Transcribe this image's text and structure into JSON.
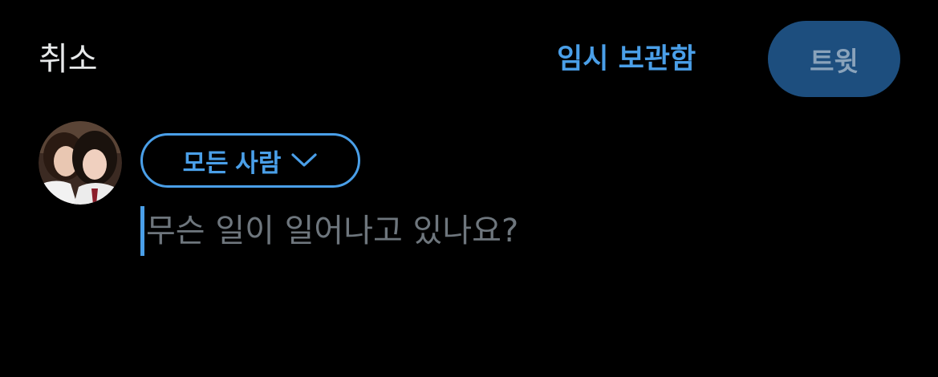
{
  "header": {
    "cancel_label": "취소",
    "drafts_label": "임시 보관함",
    "tweet_label": "트윗"
  },
  "composer": {
    "audience_label": "모든 사람",
    "audience_icon": "chevron-down-icon",
    "placeholder": "무슨 일이 일어나고 있나요?",
    "value": ""
  },
  "colors": {
    "background": "#000000",
    "accent": "#4a9fe8",
    "tweet_button_bg": "#1d4e7e",
    "tweet_button_text": "#8aa3bb",
    "placeholder": "#6e767d",
    "text": "#e7e9ea"
  }
}
